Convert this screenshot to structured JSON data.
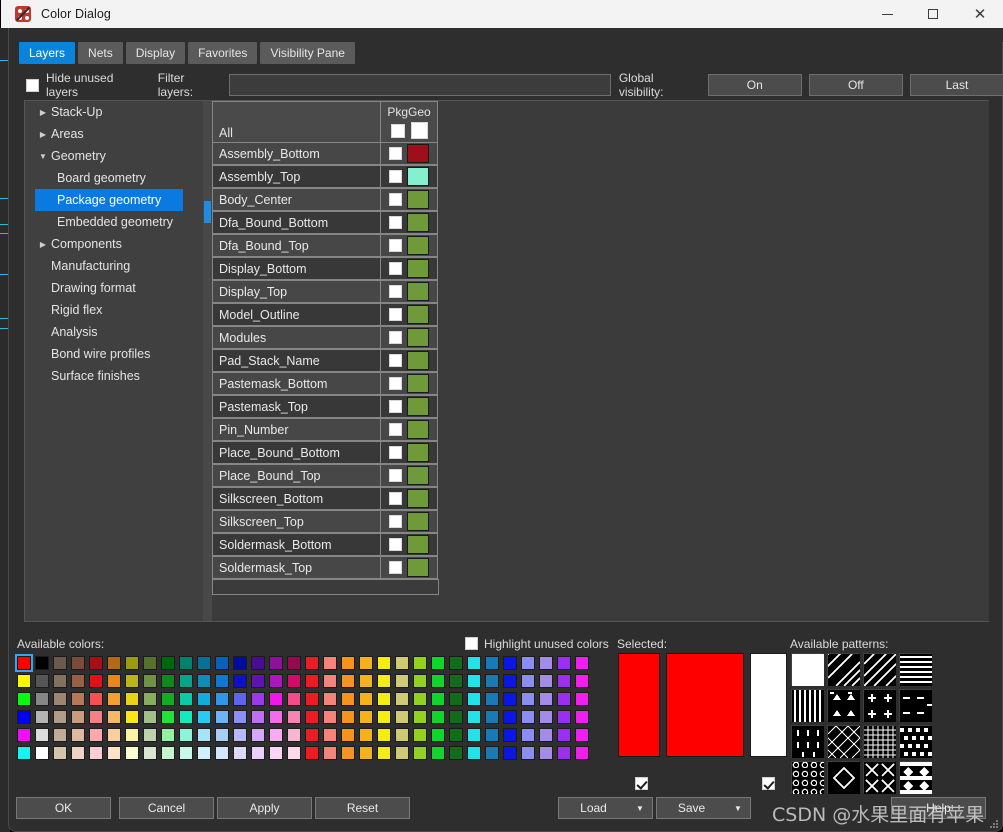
{
  "window": {
    "title": "Color Dialog",
    "icon": "color-dialog-icon",
    "minimize": "–",
    "maximize": "□",
    "close": "✕"
  },
  "tabs": [
    {
      "label": "Layers",
      "active": true
    },
    {
      "label": "Nets",
      "active": false
    },
    {
      "label": "Display",
      "active": false
    },
    {
      "label": "Favorites",
      "active": false
    },
    {
      "label": "Visibility Pane",
      "active": false
    }
  ],
  "filter_bar": {
    "hide_unused_label": "Hide unused layers",
    "hide_unused_checked": false,
    "filter_label": "Filter layers:",
    "filter_value": "",
    "filter_placeholder": "",
    "global_visibility_label": "Global visibility:",
    "buttons": [
      "On",
      "Off",
      "Last"
    ]
  },
  "tree": {
    "items": [
      {
        "label": "Stack-Up",
        "arrow": "▶",
        "indent": 0,
        "selected": false
      },
      {
        "label": "Areas",
        "arrow": "▶",
        "indent": 0,
        "selected": false
      },
      {
        "label": "Geometry",
        "arrow": "▼",
        "indent": 0,
        "selected": false
      },
      {
        "label": "Board geometry",
        "arrow": "",
        "indent": 1,
        "selected": false
      },
      {
        "label": "Package geometry",
        "arrow": "",
        "indent": 1,
        "selected": true
      },
      {
        "label": "Embedded geometry",
        "arrow": "",
        "indent": 1,
        "selected": false
      },
      {
        "label": "Components",
        "arrow": "▶",
        "indent": 0,
        "selected": false
      },
      {
        "label": "Manufacturing",
        "arrow": "",
        "indent": 0,
        "selected": false
      },
      {
        "label": "Drawing format",
        "arrow": "",
        "indent": 0,
        "selected": false
      },
      {
        "label": "Rigid flex",
        "arrow": "",
        "indent": 0,
        "selected": false
      },
      {
        "label": "Analysis",
        "arrow": "",
        "indent": 0,
        "selected": false
      },
      {
        "label": "Bond wire profiles",
        "arrow": "",
        "indent": 0,
        "selected": false
      },
      {
        "label": "Surface finishes",
        "arrow": "",
        "indent": 0,
        "selected": false
      }
    ]
  },
  "layer_table": {
    "column_header": "PkgGeo",
    "header_row_label": "All",
    "rows": [
      {
        "name": "Assembly_Bottom",
        "checked": false,
        "color": "#9e1019"
      },
      {
        "name": "Assembly_Top",
        "checked": false,
        "color": "#84f0ce"
      },
      {
        "name": "Body_Center",
        "checked": false,
        "color": "#6f9a3a"
      },
      {
        "name": "Dfa_Bound_Bottom",
        "checked": false,
        "color": "#6f9a3a"
      },
      {
        "name": "Dfa_Bound_Top",
        "checked": false,
        "color": "#6f9a3a"
      },
      {
        "name": "Display_Bottom",
        "checked": false,
        "color": "#6f9a3a"
      },
      {
        "name": "Display_Top",
        "checked": false,
        "color": "#6f9a3a"
      },
      {
        "name": "Model_Outline",
        "checked": false,
        "color": "#6f9a3a"
      },
      {
        "name": "Modules",
        "checked": false,
        "color": "#6f9a3a"
      },
      {
        "name": "Pad_Stack_Name",
        "checked": false,
        "color": "#6f9a3a"
      },
      {
        "name": "Pastemask_Bottom",
        "checked": false,
        "color": "#6f9a3a"
      },
      {
        "name": "Pastemask_Top",
        "checked": false,
        "color": "#6f9a3a"
      },
      {
        "name": "Pin_Number",
        "checked": false,
        "color": "#6f9a3a"
      },
      {
        "name": "Place_Bound_Bottom",
        "checked": false,
        "color": "#6f9a3a"
      },
      {
        "name": "Place_Bound_Top",
        "checked": false,
        "color": "#6f9a3a"
      },
      {
        "name": "Silkscreen_Bottom",
        "checked": false,
        "color": "#6f9a3a"
      },
      {
        "name": "Silkscreen_Top",
        "checked": false,
        "color": "#6f9a3a"
      },
      {
        "name": "Soldermask_Bottom",
        "checked": false,
        "color": "#6f9a3a"
      },
      {
        "name": "Soldermask_Top",
        "checked": false,
        "color": "#6f9a3a"
      }
    ]
  },
  "colors_section": {
    "available_colors_label": "Available colors:",
    "highlight_unused_label": "Highlight unused colors",
    "highlight_unused_checked": false,
    "selected_label": "Selected:",
    "available_patterns_label": "Available patterns:",
    "selected_color": "#ff0000",
    "selected_preview_color": "#ff0000",
    "selected_pattern_color": "#ffffff",
    "selected_color_checked": true,
    "selected_pattern_checked": true,
    "selected_swatch_index": 0,
    "palette_rows": [
      [
        "#fe0000",
        "#000000",
        "#6b5a4f",
        "#7b4a38",
        "#a50f16",
        "#b26a16",
        "#9a9a14",
        "#55702f",
        "#00660f",
        "#04806d",
        "#0a6f94",
        "#0b61b6",
        "#000c9e",
        "#4a0d91",
        "#8a139a",
        "#930a4e",
        "#ec1c24",
        "#f48379",
        "#f6921e",
        "#f5b21c",
        "#f5ec13",
        "#cfcb74",
        "#92d11f",
        "#10d62c",
        "#136c1b",
        "#22e3e8",
        "#1a7ab5",
        "#0a17e2",
        "#8b8df0",
        "#a38be8",
        "#9b2ff0",
        "#f01ff0"
      ],
      [
        "#fcf700",
        "#555555",
        "#84705f",
        "#9a5e44",
        "#e21018",
        "#e88715",
        "#bcb417",
        "#6f9145",
        "#0e8b17",
        "#08a489",
        "#0d8eb7",
        "#0f78d5",
        "#0c10c9",
        "#6013b5",
        "#ab16bf",
        "#d00c67",
        "#ec1c24",
        "#f48379",
        "#f6921e",
        "#f5b21c",
        "#f5ec13",
        "#cfcb74",
        "#92d11f",
        "#10d62c",
        "#136c1b",
        "#22e3e8",
        "#1a7ab5",
        "#0a17e2",
        "#8b8df0",
        "#a38be8",
        "#9b2ff0",
        "#f01ff0"
      ],
      [
        "#09f710",
        "#868686",
        "#9b8674",
        "#b5785a",
        "#f55053",
        "#f2a033",
        "#e7d317",
        "#86ad60",
        "#14ac22",
        "#0bcba4",
        "#12abdb",
        "#2f96e8",
        "#6063ed",
        "#9a3ae8",
        "#ef17ec",
        "#f54b8d",
        "#ec1c24",
        "#f48379",
        "#f6921e",
        "#f5b21c",
        "#f5ec13",
        "#cfcb74",
        "#92d11f",
        "#10d62c",
        "#136c1b",
        "#22e3e8",
        "#1a7ab5",
        "#0a17e2",
        "#8b8df0",
        "#a38be8",
        "#9b2ff0",
        "#f01ff0"
      ],
      [
        "#0000f8",
        "#b4b4b4",
        "#b09c88",
        "#c99b7f",
        "#f68184",
        "#f5b96b",
        "#fbe617",
        "#a3c184",
        "#1fe338",
        "#14eabb",
        "#2ac9f5",
        "#6eb4f3",
        "#8c8ff5",
        "#c06ef3",
        "#f56bf0",
        "#f785b3",
        "#ec1c24",
        "#f48379",
        "#f6921e",
        "#f5b21c",
        "#f5ec13",
        "#cfcb74",
        "#92d11f",
        "#10d62c",
        "#136c1b",
        "#22e3e8",
        "#1a7ab5",
        "#0a17e2",
        "#8b8df0",
        "#a38be8",
        "#9b2ff0",
        "#f01ff0"
      ],
      [
        "#f20df2",
        "#dcdcdc",
        "#c0ac97",
        "#e0b8a1",
        "#f9a9ab",
        "#f9cfa0",
        "#faf5a6",
        "#bdd3ad",
        "#96efa2",
        "#8ff3d8",
        "#a8e4f9",
        "#a8cef8",
        "#b8b7f8",
        "#d5a8f8",
        "#f7abf3",
        "#fab5d3",
        "#ec1c24",
        "#f48379",
        "#f6921e",
        "#f5b21c",
        "#f5ec13",
        "#cfcb74",
        "#92d11f",
        "#10d62c",
        "#136c1b",
        "#22e3e8",
        "#1a7ab5",
        "#0a17e2",
        "#8b8df0",
        "#a38be8",
        "#9b2ff0",
        "#f01ff0"
      ],
      [
        "#17f2f7",
        "#ffffff",
        "#d3c4ae",
        "#eed2c3",
        "#fbcdd1",
        "#fbe2cb",
        "#fcfbd2",
        "#d8e6cf",
        "#c6f5cb",
        "#c7f8ea",
        "#d2f0fc",
        "#d2e6fb",
        "#dbdafb",
        "#eacffb",
        "#fbd5f8",
        "#fcd9e9",
        "#ec1c24",
        "#f48379",
        "#f6921e",
        "#f5b21c",
        "#f5ec13",
        "#cfcb74",
        "#92d11f",
        "#10d62c",
        "#136c1b",
        "#22e3e8",
        "#1a7ab5",
        "#0a17e2",
        "#8b8df0",
        "#a38be8",
        "#9b2ff0",
        "#f01ff0"
      ]
    ],
    "patterns": [
      "solid",
      "diagonal-back-dense",
      "diagonal-fwd",
      "horizontal-lines",
      "vertical-lines",
      "triangles",
      "plus-signs",
      "dashes",
      "small-ticks",
      "crosshatch-diagonal",
      "grid-fine",
      "dots-diagonal",
      "circles",
      "diamond-outline",
      "x-cross-hatch",
      "checker-diamond"
    ]
  },
  "footer": {
    "buttons": [
      "OK",
      "Cancel",
      "Apply",
      "Reset"
    ],
    "load_label": "Load",
    "save_label": "Save",
    "help_label": "Help",
    "dropdown_arrow": "▼"
  },
  "watermark": "CSDN @水果里面有苹果"
}
